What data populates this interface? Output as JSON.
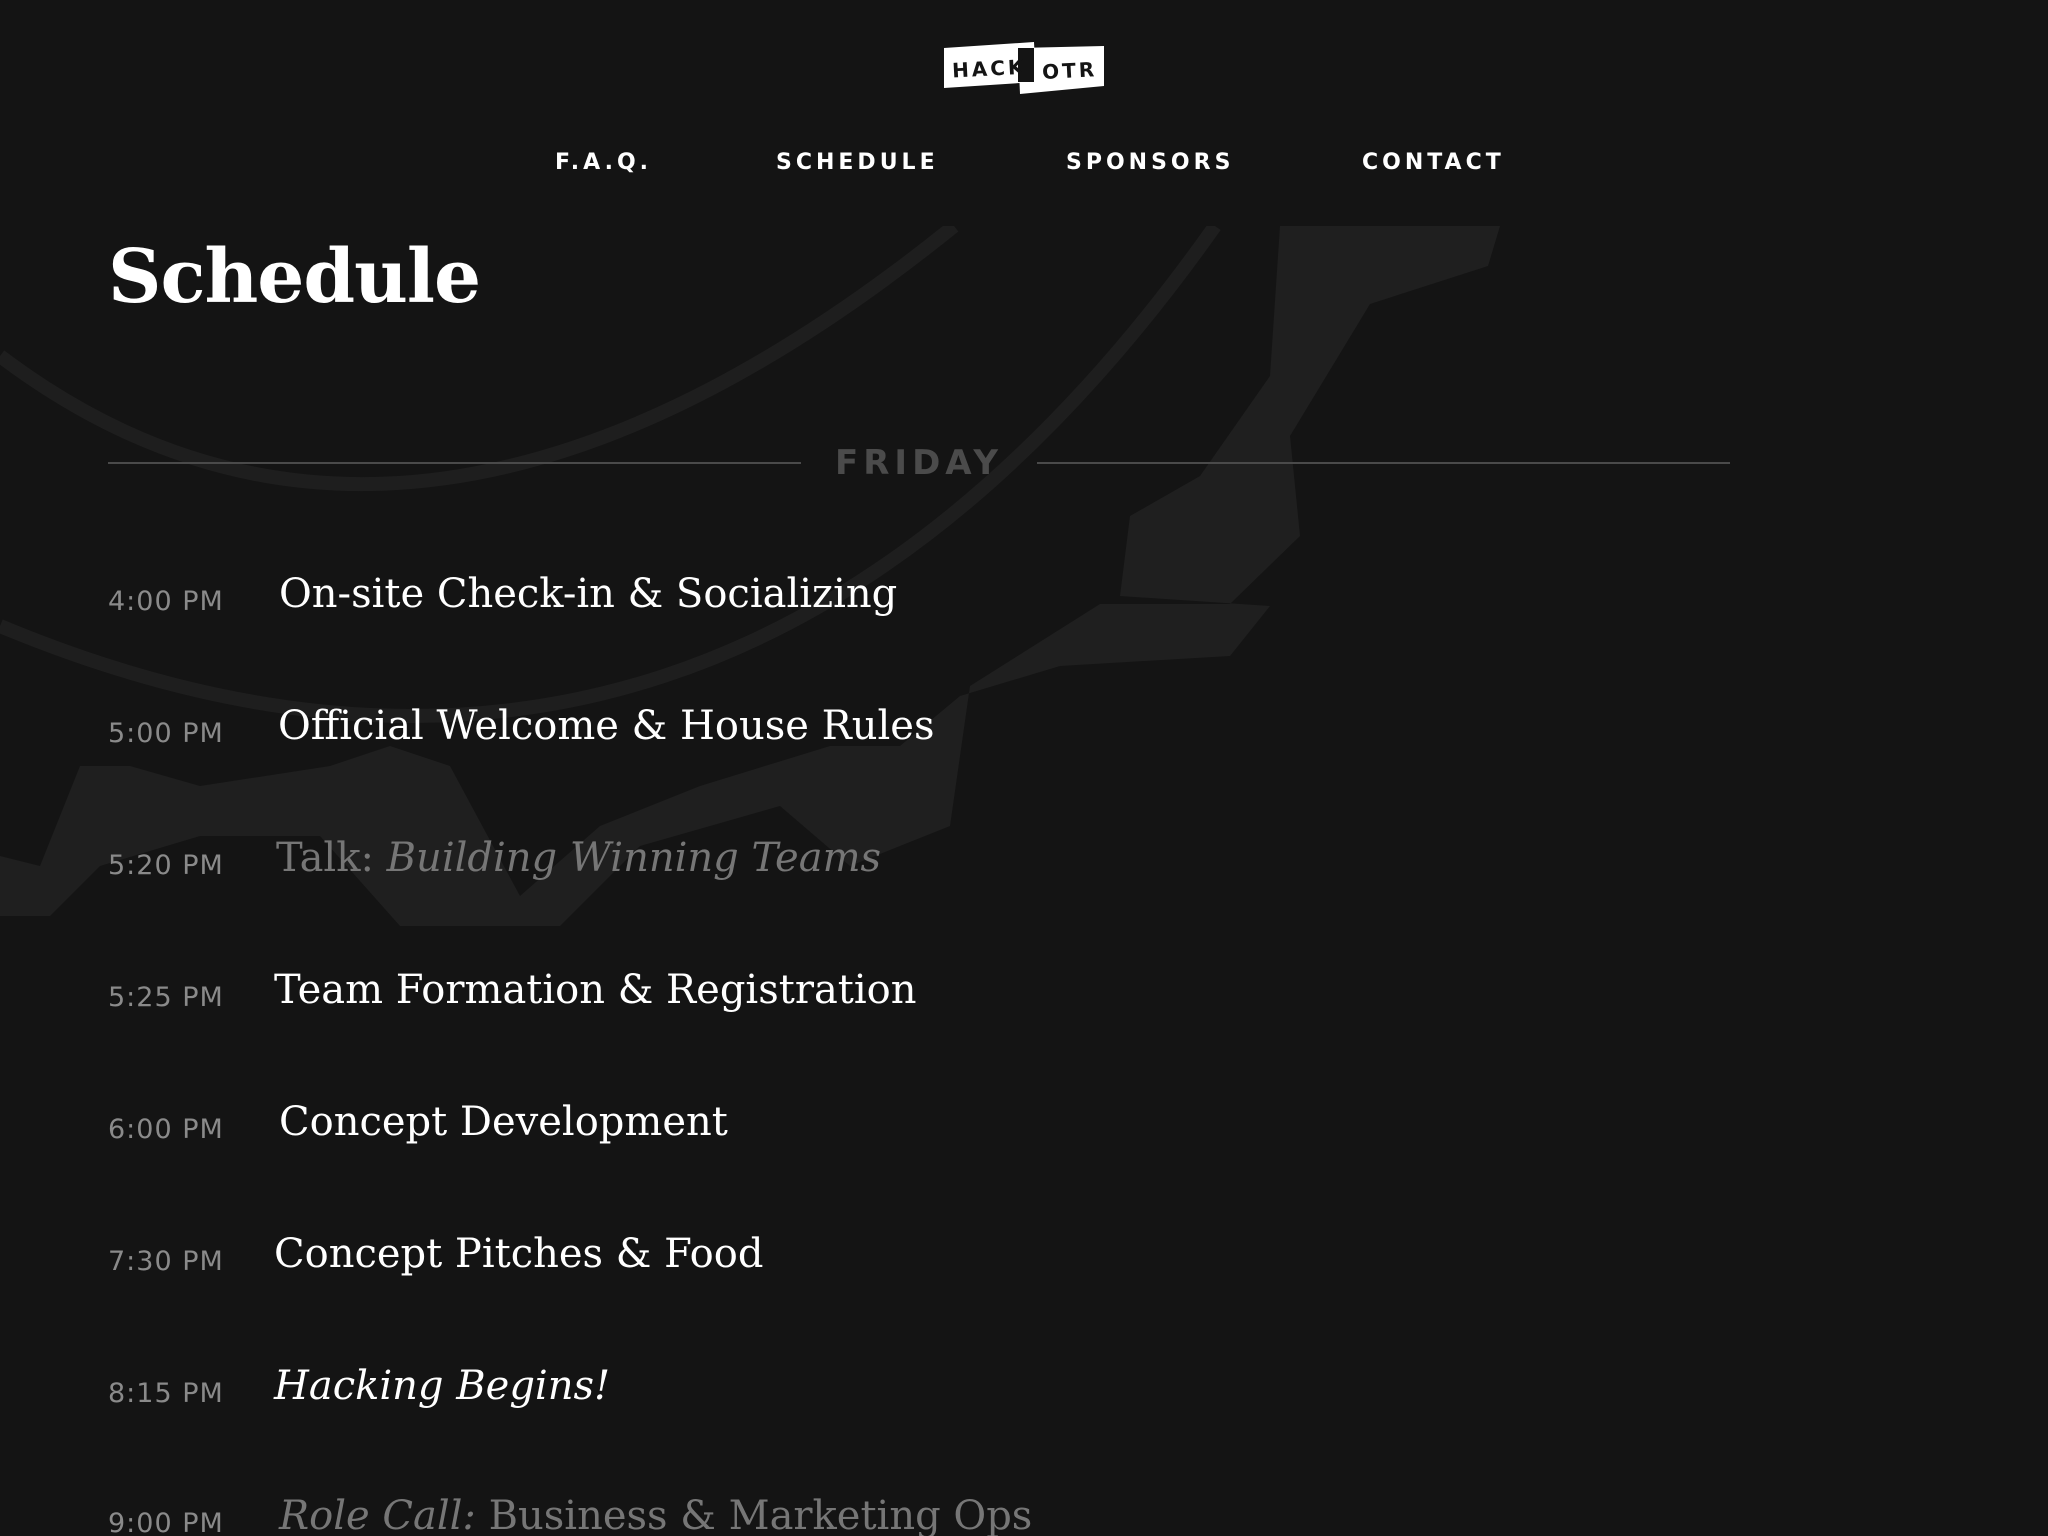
{
  "logo": {
    "word1": "HACK",
    "word2": "OTR"
  },
  "nav": [
    "F.A.Q.",
    "SCHEDULE",
    "SPONSORS",
    "CONTACT"
  ],
  "page_title": "Schedule",
  "day": "FRIDAY",
  "events": [
    {
      "time": "4:00 PM",
      "pre": "On-site Check-in & Socializing",
      "italic": "",
      "post": ""
    },
    {
      "time": "5:00 PM",
      "pre": "Official Welcome & House Rules",
      "italic": "",
      "post": ""
    },
    {
      "time": "5:20 PM",
      "pre": "Talk: ",
      "italic": "Building Winning Teams",
      "post": ""
    },
    {
      "time": "5:25 PM",
      "pre": "Team Formation & Registration",
      "italic": "",
      "post": ""
    },
    {
      "time": "6:00 PM",
      "pre": "Concept Development",
      "italic": "",
      "post": ""
    },
    {
      "time": "7:30 PM",
      "pre": "Concept Pitches & Food",
      "italic": "",
      "post": ""
    },
    {
      "time": "8:15 PM",
      "pre": "",
      "italic": "Hacking Begins!",
      "post": ""
    },
    {
      "time": "9:00 PM",
      "pre": "",
      "italic": "Role Call:",
      "post": " Business & Marketing Ops"
    }
  ],
  "colors": {
    "background": "#141414",
    "text": "#ffffff",
    "time_text": "#8a8a8a",
    "muted_title": "#767676",
    "divider": "#4a4a4a"
  }
}
